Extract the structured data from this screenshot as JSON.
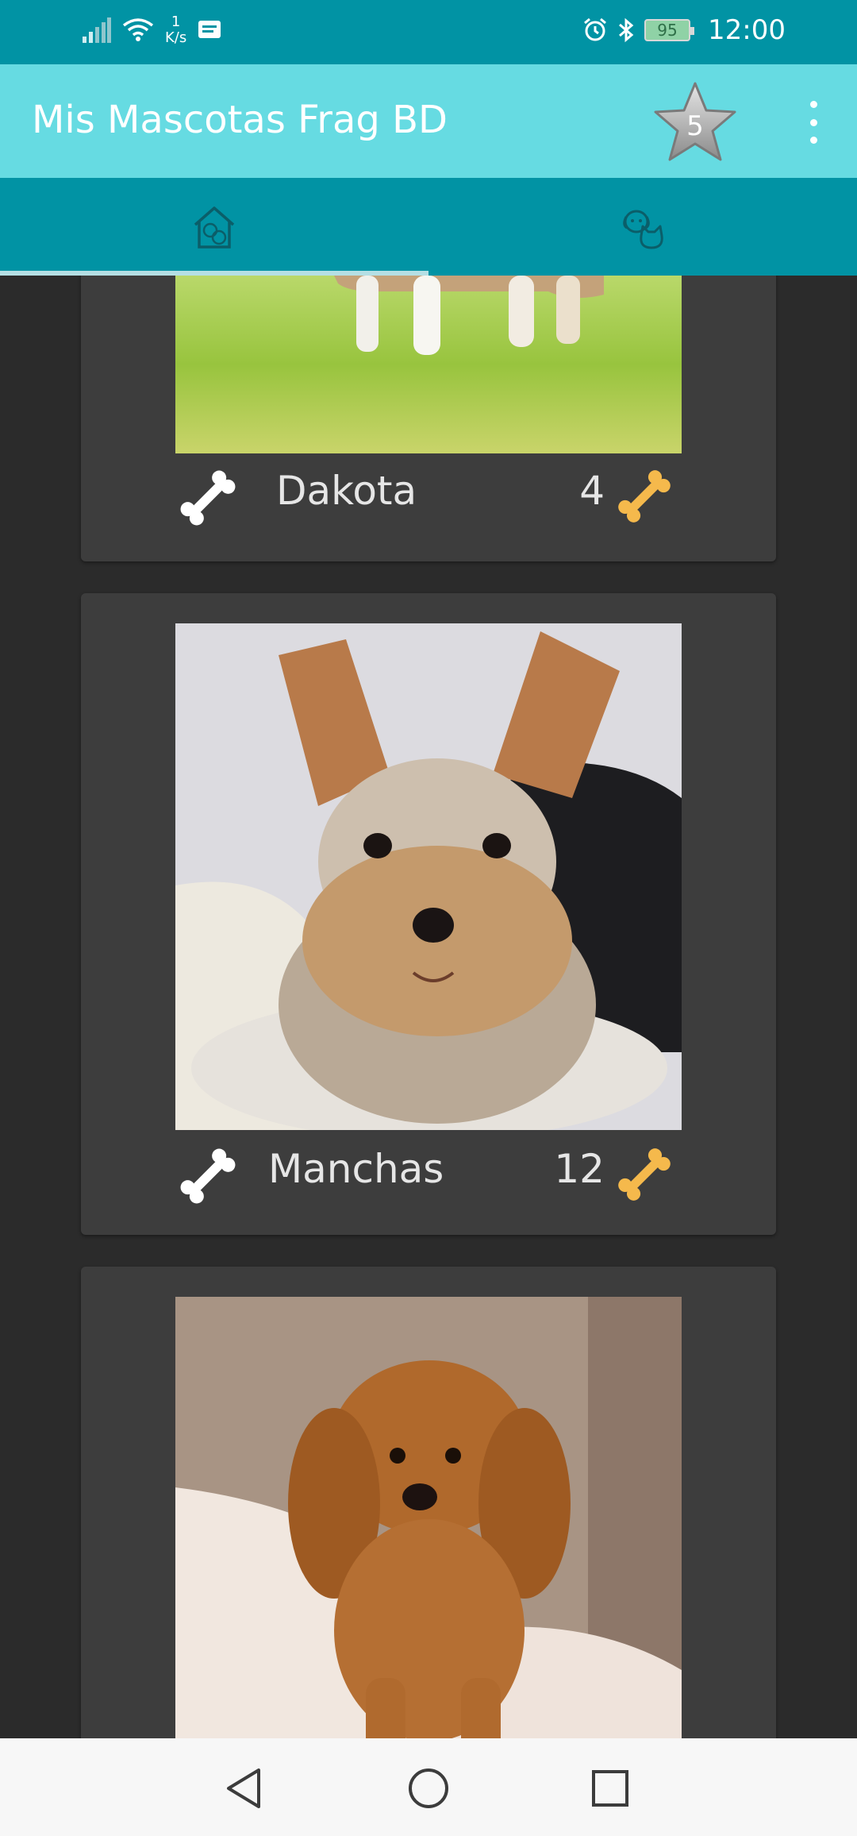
{
  "status_bar": {
    "net_speed_value": "1",
    "net_speed_unit": "K/s",
    "battery": "95",
    "time": "12:00"
  },
  "app_bar": {
    "title": "Mis Mascotas Frag BD",
    "favorites_count": "5"
  },
  "tabs": [
    {
      "icon": "pets-house-icon",
      "selected": true
    },
    {
      "icon": "dog-cat-icon",
      "selected": false
    }
  ],
  "pets": [
    {
      "name": "Dakota",
      "likes": "4"
    },
    {
      "name": "Manchas",
      "likes": "12"
    },
    {
      "name": "",
      "likes": ""
    }
  ],
  "colors": {
    "status_bar": "#0193a4",
    "app_bar": "#66dbe2",
    "tab_bar": "#0193a4",
    "background": "#2b2b2b",
    "card": "#3d3d3d",
    "bone_like": "#f5b94c",
    "bone_rate": "#ffffff"
  }
}
